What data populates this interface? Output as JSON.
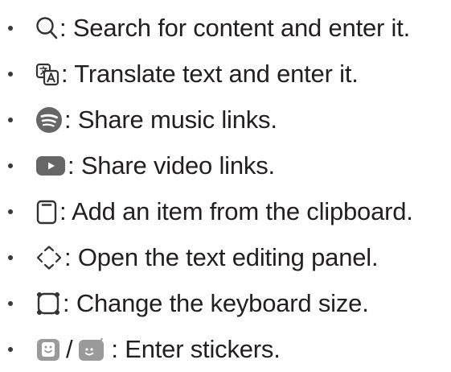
{
  "items": [
    {
      "icon": "search-icon",
      "text": ": Search for content and enter it."
    },
    {
      "icon": "translate-icon",
      "text": ": Translate text and enter it."
    },
    {
      "icon": "spotify-icon",
      "text": ": Share music links."
    },
    {
      "icon": "youtube-icon",
      "text": ": Share video links."
    },
    {
      "icon": "clipboard-icon",
      "text": ": Add an item from the clipboard."
    },
    {
      "icon": "text-editing-panel-icon",
      "text": ": Open the text editing panel."
    },
    {
      "icon": "keyboard-size-icon",
      "text": ": Change the keyboard size."
    },
    {
      "icon": "sticker-icon",
      "icon2": "sticker-alt-icon",
      "separator": "/",
      "text": ": Enter stickers."
    }
  ],
  "colors": {
    "text": "#231f20",
    "icon_gray": "#666666",
    "icon_light_gray": "#9a9a9a"
  }
}
